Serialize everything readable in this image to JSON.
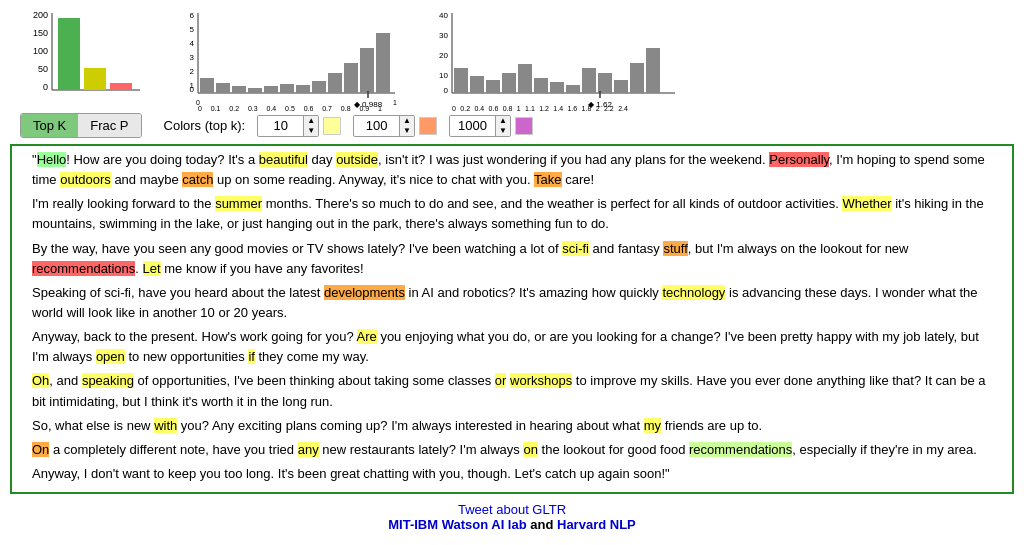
{
  "charts": {
    "chart1": {
      "bars": [
        {
          "color": "#4CAF50",
          "height": 70,
          "width": 28
        },
        {
          "color": "#cdcd00",
          "height": 22,
          "width": 28
        },
        {
          "color": "#ff6666",
          "height": 8,
          "width": 28
        }
      ],
      "yLabels": [
        "200",
        "150",
        "100",
        "50",
        "0"
      ]
    },
    "chart2": {
      "title": "",
      "yLabels": [
        "6",
        "5",
        "4",
        "3",
        "2",
        "1",
        "0"
      ],
      "xLabel": "0.988",
      "xAxisLabels": [
        "0",
        "0.1",
        "0.2",
        "0.3",
        "0.4",
        "0.5",
        "0.6",
        "0.7",
        "0.8",
        "0.9",
        "1"
      ]
    },
    "chart3": {
      "yLabels": [
        "40",
        "30",
        "20",
        "10",
        "0"
      ],
      "xLabel": "1.62",
      "xAxisLabels": [
        "0",
        "0.2",
        "0.4",
        "0.6",
        "0.8",
        "1",
        "1.1",
        "1.2",
        "1.4",
        "1.6",
        "1.8",
        "2",
        "2.2",
        "2.4"
      ]
    }
  },
  "controls": {
    "topK_label": "Top K",
    "fracP_label": "Frac P",
    "colors_label": "Colors (top k):",
    "spinner1_value": "10",
    "swatch1_color": "#ffff99",
    "spinner2_value": "100",
    "swatch2_color": "#ff9966",
    "spinner3_value": "1000",
    "swatch3_color": "#cc66cc"
  },
  "text_lines": [
    {
      "parts": [
        {
          "text": "\"",
          "highlight": null
        },
        {
          "text": "Hello",
          "highlight": "green"
        },
        {
          "text": "! How are you doing today? It's a ",
          "highlight": null
        },
        {
          "text": "beautiful",
          "highlight": "yellow"
        },
        {
          "text": " day ",
          "highlight": null
        },
        {
          "text": "outside",
          "highlight": "yellow"
        },
        {
          "text": ", isn't it? I was just wondering if you had any plans for the",
          "highlight": null
        }
      ]
    }
  ],
  "full_text_html": true,
  "footer": {
    "tweet_label": "Tweet about GLTR",
    "tweet_url": "#",
    "lab1": "MIT-IBM Watson AI lab",
    "lab1_url": "#",
    "and_text": " and ",
    "lab2": "Harvard NLP",
    "lab2_url": "#"
  }
}
